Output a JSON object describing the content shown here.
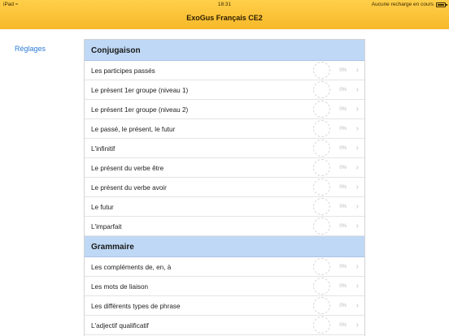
{
  "status_bar": {
    "device": "iPad",
    "time": "18:31",
    "charge": "Aucune recharge en cours"
  },
  "nav": {
    "title": "ExoGus Français CE2"
  },
  "sidebar": {
    "settings": "Réglages"
  },
  "icons": {
    "wifi": "wifi-icon",
    "battery": "battery-icon",
    "chevron": "chevron-right-icon",
    "progress": "progress-ring-icon"
  },
  "sections": [
    {
      "title": "Conjugaison",
      "rows": [
        {
          "label": "Les participes passés",
          "progress": "0%"
        },
        {
          "label": "Le présent 1er groupe (niveau 1)",
          "progress": "0%"
        },
        {
          "label": "Le présent 1er groupe (niveau 2)",
          "progress": "0%"
        },
        {
          "label": "Le passé, le présent, le futur",
          "progress": "0%"
        },
        {
          "label": "L'infinitif",
          "progress": "0%"
        },
        {
          "label": "Le présent du verbe être",
          "progress": "0%"
        },
        {
          "label": "Le présent du verbe avoir",
          "progress": "0%"
        },
        {
          "label": "Le futur",
          "progress": "0%"
        },
        {
          "label": "L'imparfait",
          "progress": "0%"
        }
      ]
    },
    {
      "title": "Grammaire",
      "rows": [
        {
          "label": "Les compléments de, en, à",
          "progress": "0%"
        },
        {
          "label": "Les mots de liaison",
          "progress": "0%"
        },
        {
          "label": "Les différents types de phrase",
          "progress": "0%"
        },
        {
          "label": "L'adjectif qualificatif",
          "progress": "0%"
        }
      ]
    }
  ]
}
